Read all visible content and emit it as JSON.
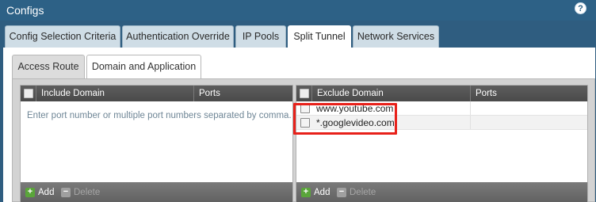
{
  "window": {
    "title": "Configs"
  },
  "tabs": [
    {
      "label": "Config Selection Criteria"
    },
    {
      "label": "Authentication Override"
    },
    {
      "label": "IP Pools"
    },
    {
      "label": "Split Tunnel"
    },
    {
      "label": "Network Services"
    }
  ],
  "active_tab": "Split Tunnel",
  "subtabs": [
    {
      "label": "Access Route"
    },
    {
      "label": "Domain and Application"
    }
  ],
  "active_subtab": "Domain and Application",
  "include_grid": {
    "col_domain": "Include Domain",
    "col_ports": "Ports",
    "placeholder": "Enter port number or multiple port numbers separated by comma.",
    "add_label": "Add",
    "delete_label": "Delete"
  },
  "exclude_grid": {
    "col_domain": "Exclude Domain",
    "col_ports": "Ports",
    "rows": [
      {
        "domain": "www.youtube.com",
        "ports": ""
      },
      {
        "domain": "*.googlevideo.com",
        "ports": ""
      }
    ],
    "add_label": "Add",
    "delete_label": "Delete"
  },
  "icons": {
    "help": "help-icon",
    "add": "plus-icon",
    "delete": "minus-icon",
    "highlight_color": "#e8211a"
  }
}
